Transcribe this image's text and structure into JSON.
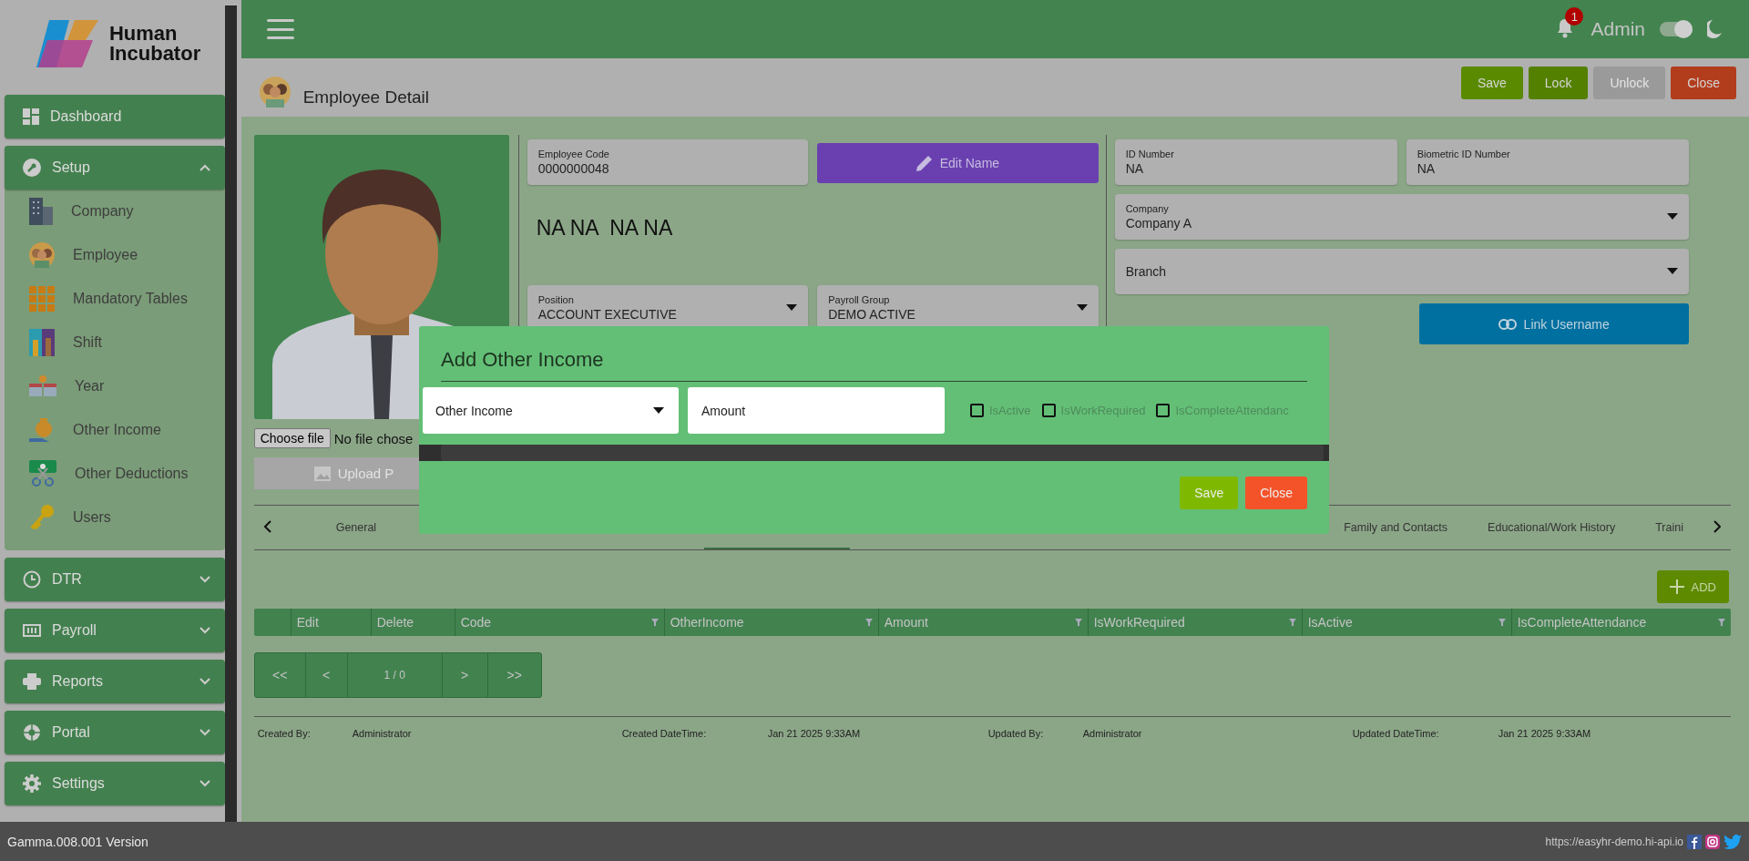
{
  "sidebar": {
    "logo": {
      "line_1": "Human",
      "line_2": "Incubator"
    },
    "dashboard": {
      "label": "Dashboard"
    },
    "groups": [
      {
        "label": "Setup",
        "expanded": true,
        "children": [
          {
            "label": "Company"
          },
          {
            "label": "Employee"
          },
          {
            "label": "Mandatory Tables"
          },
          {
            "label": "Shift"
          },
          {
            "label": "Year"
          },
          {
            "label": "Other Income"
          },
          {
            "label": "Other Deductions"
          },
          {
            "label": "Users"
          }
        ]
      },
      {
        "label": "DTR",
        "expanded": false
      },
      {
        "label": "Payroll",
        "expanded": false
      },
      {
        "label": "Reports",
        "expanded": false
      },
      {
        "label": "Portal",
        "expanded": false
      },
      {
        "label": "Settings",
        "expanded": false
      }
    ]
  },
  "topbar": {
    "notification_count": "1",
    "user": "Admin",
    "dark_mode": {
      "on": true
    }
  },
  "header": {
    "title": "Employee Detail",
    "actions": [
      {
        "label": "Save",
        "kind": "save",
        "disabled": false
      },
      {
        "label": "Lock",
        "kind": "lock",
        "disabled": false
      },
      {
        "label": "Unlock",
        "kind": "unlock",
        "disabled": true
      },
      {
        "label": "Close",
        "kind": "close",
        "disabled": false
      }
    ]
  },
  "photo": {
    "file_button": "Choose file",
    "file_status": "No file chose",
    "upload": "Upload P"
  },
  "employee": {
    "code_label": "Employee Code",
    "code": "0000000048",
    "edit_name": "Edit Name",
    "full_name": "NA NA  NA NA",
    "position": {
      "label": "Position",
      "value": "ACCOUNT EXECUTIVE"
    },
    "payroll_group": {
      "label": "Payroll Group",
      "value": "DEMO ACTIVE"
    },
    "id_number": {
      "label": "ID Number",
      "value": "NA"
    },
    "biometric_id": {
      "label": "Biometric ID Number",
      "value": "NA"
    },
    "company": {
      "label": "Company",
      "value": "Company A"
    },
    "branch": {
      "placeholder": "Branch"
    },
    "link_username": "Link Username"
  },
  "tabs": [
    {
      "label": "General",
      "selected": false
    },
    {
      "label": "Family and Contacts",
      "selected": false
    },
    {
      "label": "Educational/Work History",
      "selected": false
    },
    {
      "label": "Traini",
      "selected": false
    }
  ],
  "add_button": "ADD",
  "table": {
    "columns": [
      {
        "label": "Edit",
        "filter": false
      },
      {
        "label": "Delete",
        "filter": false
      },
      {
        "label": "Code",
        "filter": true
      },
      {
        "label": "OtherIncome",
        "filter": true
      },
      {
        "label": "Amount",
        "filter": true
      },
      {
        "label": "IsWorkRequired",
        "filter": true
      },
      {
        "label": "IsActive",
        "filter": true
      },
      {
        "label": "IsCompleteAttendance",
        "filter": true
      }
    ]
  },
  "pagination": {
    "first": "<<",
    "prev": "<",
    "page": "1 / 0",
    "next": ">",
    "last": ">>"
  },
  "audit": [
    {
      "label": "Created By:",
      "value": "Administrator"
    },
    {
      "label": "Created DateTime:",
      "value": "Jan 21 2025 9:33AM"
    },
    {
      "label": "Updated By:",
      "value": "Administrator"
    },
    {
      "label": "Updated DateTime:",
      "value": "Jan 21 2025 9:33AM"
    }
  ],
  "modal": {
    "title": "Add Other Income",
    "income_select": {
      "value": "Other Income"
    },
    "amount": {
      "placeholder": "Amount"
    },
    "checkboxes": [
      {
        "label": "IsActive",
        "checked": false
      },
      {
        "label": "IsWorkRequired",
        "checked": false
      },
      {
        "label": "IsCompleteAttendanc",
        "checked": false
      }
    ],
    "save": "Save",
    "close": "Close"
  },
  "footer": {
    "version": "Gamma.008.001 Version",
    "url": "https://easyhr-demo.hi-api.io"
  }
}
